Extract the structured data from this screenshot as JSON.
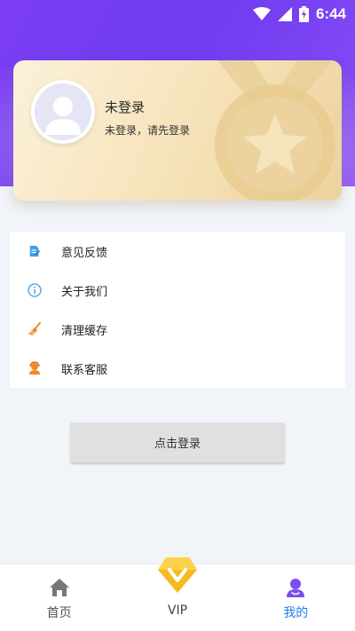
{
  "status_bar": {
    "time": "6:44"
  },
  "card": {
    "title": "未登录",
    "subtitle": "未登录，请先登录"
  },
  "menu": {
    "items": [
      {
        "label": "意见反馈",
        "icon": "feedback-icon",
        "color": "#3aa0e8"
      },
      {
        "label": "关于我们",
        "icon": "info-icon",
        "color": "#3aa0e8"
      },
      {
        "label": "清理缓存",
        "icon": "broom-icon",
        "color": "#f08a24"
      },
      {
        "label": "联系客服",
        "icon": "customer-service-icon",
        "color": "#f08a24"
      }
    ]
  },
  "login_button": {
    "label": "点击登录"
  },
  "tabbar": {
    "tabs": [
      {
        "label": "首页",
        "icon": "home-icon",
        "active": false
      },
      {
        "label": "VIP",
        "icon": "vip-diamond-icon",
        "active": false
      },
      {
        "label": "我的",
        "icon": "profile-icon",
        "active": true
      }
    ]
  },
  "colors": {
    "header_purple": "#7b3df2",
    "active_tab": "#1f7fe8",
    "card_gold": "#f6e2b8"
  }
}
